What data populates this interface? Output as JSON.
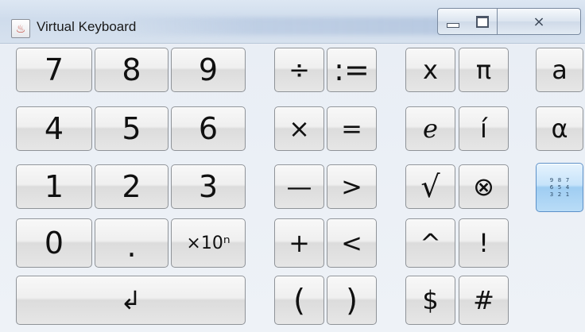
{
  "window": {
    "title": "Virtual Keyboard",
    "icon": "java-cup-icon",
    "controls": {
      "minimize": "minimize-icon",
      "maximize": "maximize-icon",
      "close_label": "⨯"
    }
  },
  "keys": {
    "digits": {
      "k7": "7",
      "k8": "8",
      "k9": "9",
      "k4": "4",
      "k5": "5",
      "k6": "6",
      "k1": "1",
      "k2": "2",
      "k3": "3",
      "k0": "0",
      "dot": ".",
      "exp": "×10ⁿ",
      "enter": "↲"
    },
    "operators": {
      "divide": "÷",
      "assign": ":=",
      "times": "×",
      "equals": "=",
      "minus": "—",
      "greater": ">",
      "plus": "+",
      "less": "<",
      "lparen": "(",
      "rparen": ")"
    },
    "functions": {
      "x": "x",
      "pi": "π",
      "e": "e",
      "i": "í",
      "sqrt": "√",
      "otimes": "⊗",
      "caret": "^",
      "factorial": "!",
      "dollar": "$",
      "hash": "#"
    },
    "modes": {
      "latin": "a",
      "greek": "α",
      "numeric_grid": [
        "9",
        "8",
        "7",
        "6",
        "5",
        "4",
        "3",
        "2",
        "1"
      ]
    }
  }
}
